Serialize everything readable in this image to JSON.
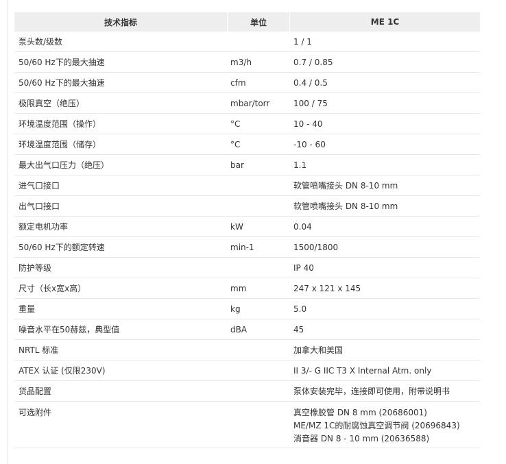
{
  "table": {
    "headers": [
      "技术指标",
      "单位",
      "ME 1C"
    ],
    "rows": [
      {
        "spec": "泵头数/级数",
        "unit": "",
        "value": "1 / 1"
      },
      {
        "spec": "50/60 Hz下的最大抽速",
        "unit": "m3/h",
        "value": "0.7 / 0.85"
      },
      {
        "spec": "50/60 Hz下的最大抽速",
        "unit": "cfm",
        "value": "0.4 / 0.5"
      },
      {
        "spec": "极限真空（绝压）",
        "unit": "mbar/torr",
        "value": "100 / 75"
      },
      {
        "spec": "环境温度范围（操作）",
        "unit": "°C",
        "value": "10 - 40"
      },
      {
        "spec": "环境温度范围（储存）",
        "unit": "°C",
        "value": "-10 - 60"
      },
      {
        "spec": "最大出气口压力（绝压）",
        "unit": "bar",
        "value": "1.1"
      },
      {
        "spec": "进气口接口",
        "unit": "",
        "value": "软管喷嘴接头 DN 8-10 mm"
      },
      {
        "spec": "出气口接口",
        "unit": "",
        "value": "软管喷嘴接头 DN 8-10 mm"
      },
      {
        "spec": "额定电机功率",
        "unit": "kW",
        "value": "0.04"
      },
      {
        "spec": "50/60 Hz下的额定转速",
        "unit": "min-1",
        "value": "1500/1800"
      },
      {
        "spec": "防护等级",
        "unit": "",
        "value": "IP 40"
      },
      {
        "spec": "尺寸（长x宽x高）",
        "unit": "mm",
        "value": "247 x 121 x 145"
      },
      {
        "spec": "重量",
        "unit": "kg",
        "value": "5.0"
      },
      {
        "spec": "噪音水平在50赫兹，典型值",
        "unit": "dBA",
        "value": "45"
      },
      {
        "spec": "NRTL 标准",
        "unit": "",
        "value": "加拿大和美国"
      },
      {
        "spec": "ATEX 认证 (仅限230V)",
        "unit": "",
        "value": "II 3/- G IIC T3 X Internal Atm. only"
      },
      {
        "spec": "货品配置",
        "unit": "",
        "value": "泵体安装完毕，连接即可使用，附带说明书"
      }
    ],
    "accessories": {
      "spec": "可选附件",
      "unit": "",
      "values": [
        "真空橡胶管 DN 8 mm (20686001)",
        "ME/MZ 1C的耐腐蚀真空调节阀 (20696843)",
        "消音器 DN 8 - 10 mm (20636588)"
      ]
    }
  }
}
